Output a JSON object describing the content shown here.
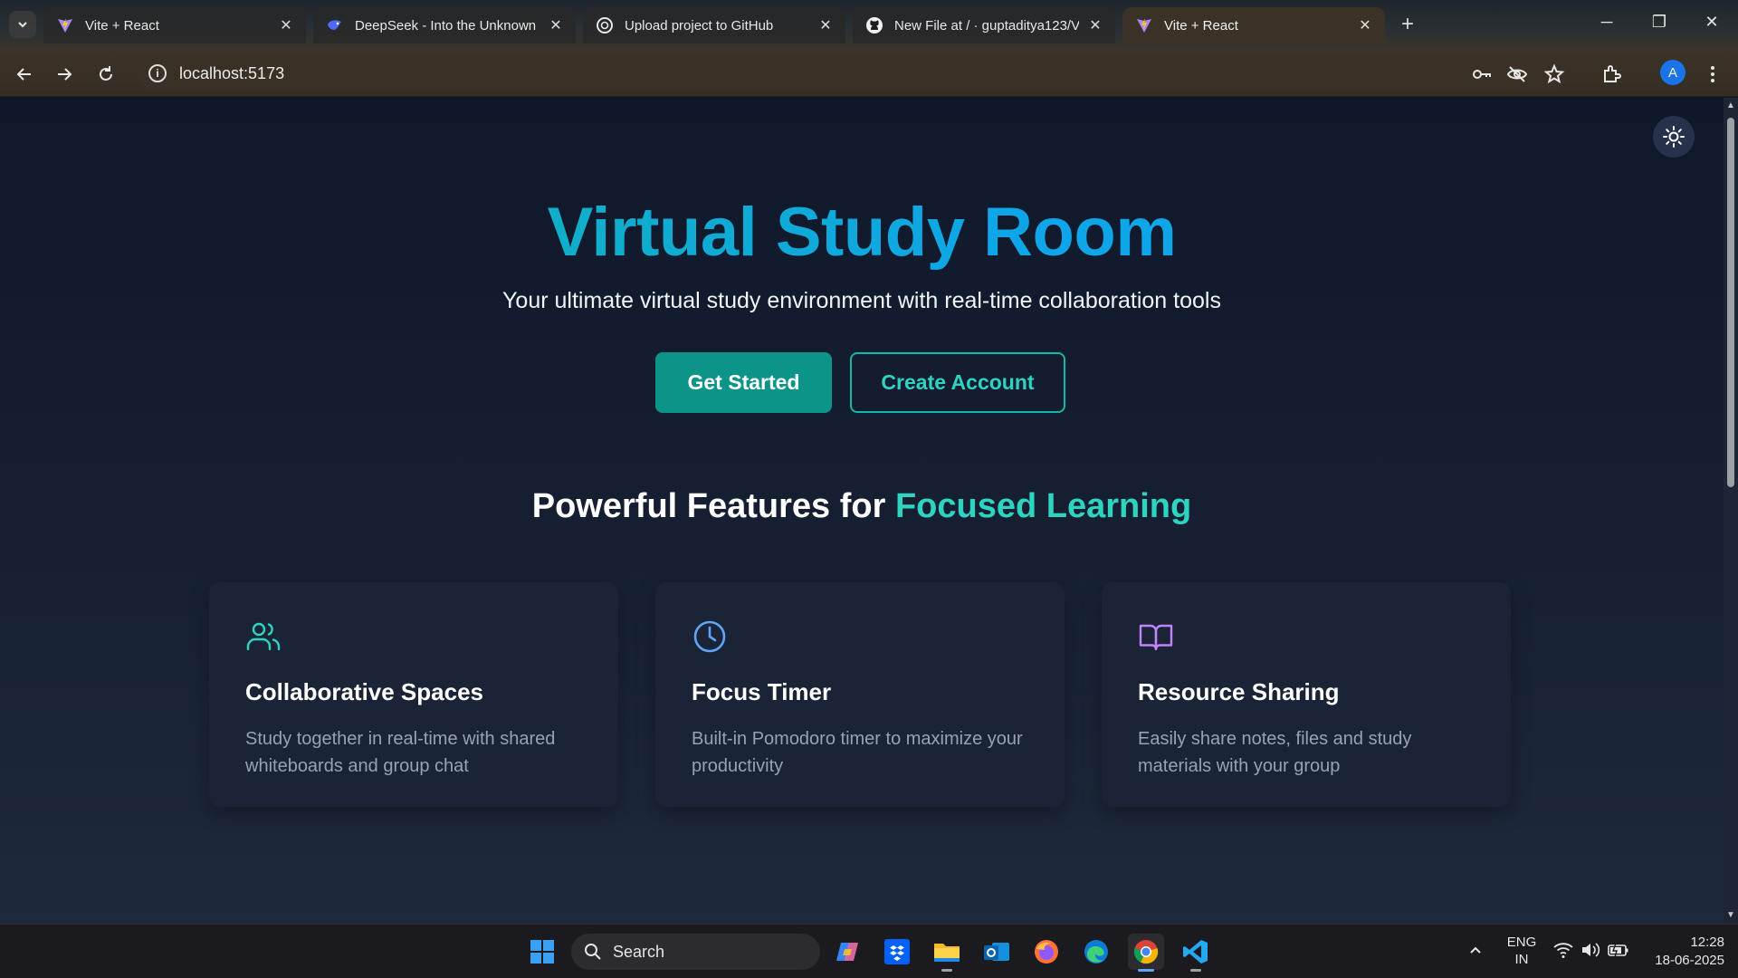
{
  "browser": {
    "tabs": [
      {
        "title": "Vite + React",
        "icon": "vite-icon",
        "active": false
      },
      {
        "title": "DeepSeek - Into the Unknown",
        "icon": "deepseek-icon",
        "active": false
      },
      {
        "title": "Upload project to GitHub",
        "icon": "openai-icon",
        "active": false
      },
      {
        "title": "New File at / · guptaditya123/V",
        "icon": "github-icon",
        "active": false
      },
      {
        "title": "Vite + React",
        "icon": "vite-icon",
        "active": true
      }
    ],
    "address": "localhost:5173",
    "profile_initial": "A"
  },
  "page": {
    "hero": {
      "title": "Virtual Study Room",
      "subtitle": "Your ultimate virtual study environment with real-time collaboration tools",
      "primary_button": "Get Started",
      "secondary_button": "Create Account"
    },
    "features": {
      "heading_prefix": "Powerful Features for ",
      "heading_accent": "Focused Learning",
      "cards": [
        {
          "title": "Collaborative Spaces",
          "description": "Study together in real-time with shared whiteboards and group chat",
          "icon": "users-icon",
          "icon_color": "#2dd4bf"
        },
        {
          "title": "Focus Timer",
          "description": "Built-in Pomodoro timer to maximize your productivity",
          "icon": "clock-icon",
          "icon_color": "#60a5fa"
        },
        {
          "title": "Resource Sharing",
          "description": "Easily share notes, files and study materials with your group",
          "icon": "book-open-icon",
          "icon_color": "#c084fc"
        }
      ]
    },
    "colors": {
      "accent": "#14b8a6",
      "accent_blue": "#0ea5e9",
      "background": "#0f172a"
    }
  },
  "taskbar": {
    "search_placeholder": "Search",
    "language": "ENG",
    "region": "IN",
    "time": "12:28",
    "date": "18-06-2025"
  }
}
